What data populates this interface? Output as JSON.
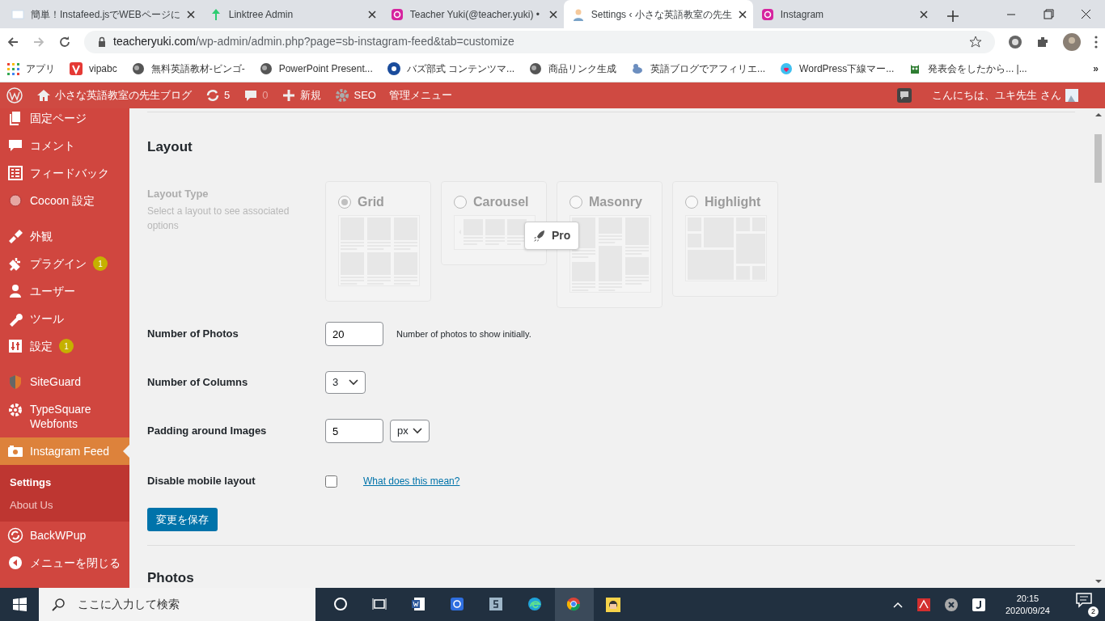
{
  "browser": {
    "tabs": [
      {
        "title": "簡単！Instafeed.jsでWEBページに",
        "selected": false
      },
      {
        "title": "Linktree Admin",
        "selected": false
      },
      {
        "title": "Teacher Yuki(@teacher.yuki) •",
        "selected": false
      },
      {
        "title": "Settings ‹ 小さな英語教室の先生",
        "selected": true
      },
      {
        "title": "Instagram",
        "selected": false
      }
    ],
    "url_host": "teacheryuki.com",
    "url_path": "/wp-admin/admin.php?page=sb-instagram-feed&tab=customize",
    "bookmarks": [
      "アプリ",
      "vipabc",
      "無料英語教材-ビンゴ-",
      "PowerPoint Present...",
      "バズ部式 コンテンツマ...",
      "商品リンク生成",
      "英語ブログでアフィリエ...",
      "WordPress下線マー...",
      "発表会をしたから... |..."
    ],
    "more_bookmarks": "»"
  },
  "admin_bar": {
    "site_name": "小さな英語教室の先生ブログ",
    "updates": "5",
    "comments": "0",
    "new": "新規",
    "seo": "SEO",
    "menu": "管理メニュー",
    "greeting": "こんにちは、ユキ先生 さん"
  },
  "sidebar": {
    "groups": [
      {
        "items": [
          {
            "label": "固定ページ",
            "selected": false
          },
          {
            "label": "コメント",
            "selected": false
          },
          {
            "label": "フィードバック",
            "selected": false
          },
          {
            "label": "Cocoon 設定",
            "selected": false
          }
        ]
      },
      {
        "items": [
          {
            "label": "外観",
            "selected": false
          },
          {
            "label": "プラグイン",
            "badge": "1",
            "selected": false
          },
          {
            "label": "ユーザー",
            "selected": false
          },
          {
            "label": "ツール",
            "selected": false
          },
          {
            "label": "設定",
            "badge": "1",
            "selected": false
          }
        ]
      },
      {
        "items": [
          {
            "label": "SiteGuard",
            "selected": false
          },
          {
            "label": "TypeSquare Webfonts",
            "selected": false
          },
          {
            "label": "Instagram Feed",
            "selected": true,
            "children": [
              {
                "label": "Settings",
                "selected": true
              },
              {
                "label": "About Us",
                "selected": false
              }
            ]
          },
          {
            "label": "BackWPup",
            "selected": false
          },
          {
            "label": "メニューを閉じる",
            "selected": false
          }
        ]
      }
    ]
  },
  "section_title": "Layout",
  "layout_type": {
    "label": "Layout Type",
    "description": "Select a layout to see associated options",
    "disabled": true,
    "pro_badge": "Pro",
    "options": [
      {
        "kind": "grid",
        "label": "Grid",
        "selected": true
      },
      {
        "kind": "carousel",
        "label": "Carousel",
        "selected": false
      },
      {
        "kind": "masonry",
        "label": "Masonry",
        "selected": false
      },
      {
        "kind": "highlight",
        "label": "Highlight",
        "selected": false
      }
    ]
  },
  "fields": [
    {
      "kind": "number",
      "label": "Number of Photos",
      "value": "20",
      "hint": "Number of photos to show initially."
    },
    {
      "kind": "select",
      "label": "Number of Columns",
      "value": "3"
    },
    {
      "kind": "number_unit",
      "label": "Padding around Images",
      "value": "5",
      "unit": "px"
    },
    {
      "kind": "checkbox",
      "label": "Disable mobile layout",
      "checked": false,
      "link": "What does this mean?"
    }
  ],
  "save_button": "変更を保存",
  "next_section_title": "Photos",
  "taskbar": {
    "search_placeholder": "ここに入力して検索",
    "time": "20:15",
    "date": "2020/09/24",
    "notifications": "2"
  }
}
